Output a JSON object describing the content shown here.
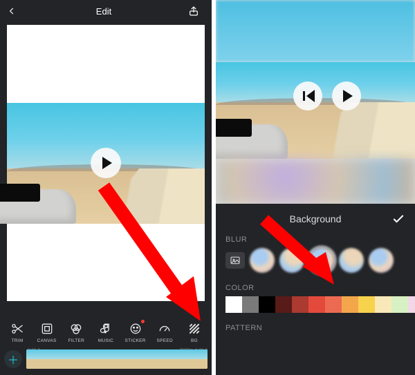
{
  "left": {
    "title": "Edit",
    "tools": [
      {
        "id": "trim",
        "label": "TRIM"
      },
      {
        "id": "canvas",
        "label": "CANVAS"
      },
      {
        "id": "filter",
        "label": "FILTER"
      },
      {
        "id": "music",
        "label": "MUSIC"
      },
      {
        "id": "sticker",
        "label": "STICKER",
        "dot": true
      },
      {
        "id": "speed",
        "label": "SPEED"
      },
      {
        "id": "bg",
        "label": "BG"
      }
    ],
    "timeline": {
      "current": "0:05.0",
      "total_label": "TOTAL",
      "total": "0:20.0"
    }
  },
  "right": {
    "panel_title": "Background",
    "sections": {
      "blur": "BLUR",
      "color": "COLOR",
      "pattern": "PATTERN"
    },
    "blur_options": 5,
    "selected_blur": 2,
    "colors": [
      "#ffffff",
      "#7a7a7a",
      "#000000",
      "#591b18",
      "#ab3a30",
      "#e44a3c",
      "#ed6a52",
      "#f4a64a",
      "#f7d24d",
      "#f9e9b9",
      "#d7f1c4",
      "#f1d7e7",
      "#f29fc4",
      "#ec5fa1",
      "#e42e89",
      "#c9227b"
    ]
  }
}
